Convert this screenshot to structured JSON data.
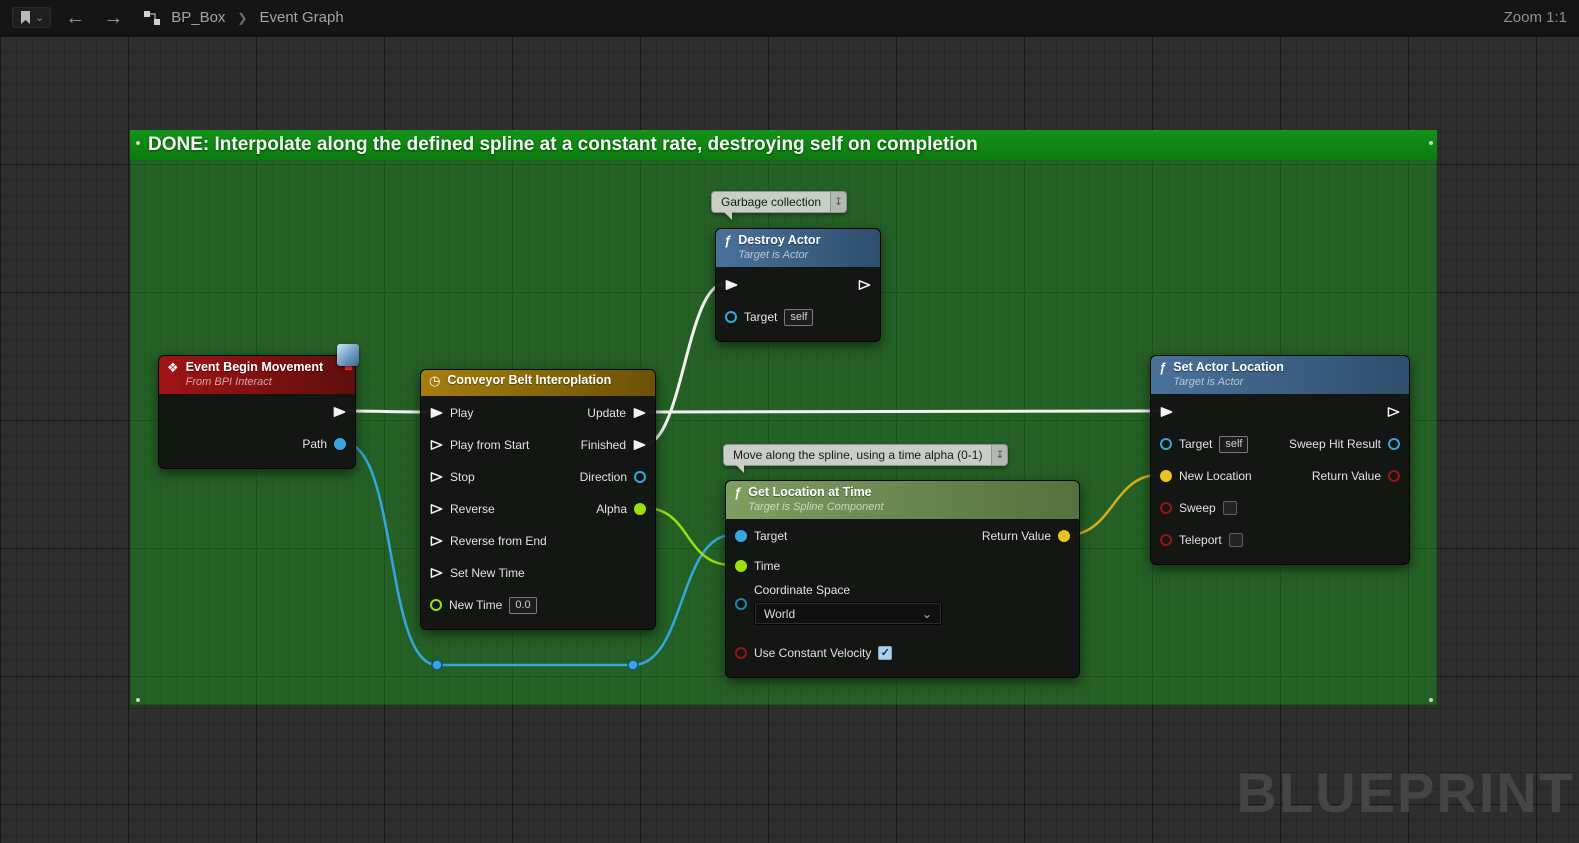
{
  "toolbar": {
    "breadcrumb_root": "BP_Box",
    "breadcrumb_current": "Event Graph",
    "zoom_label": "Zoom 1:1"
  },
  "comment": {
    "title": "DONE: Interpolate along the defined spline at a constant rate, destroying self on completion"
  },
  "watermark": "BLUEPRINT",
  "icons": {
    "function": "ƒ",
    "event": "❖",
    "clock": "◷",
    "back_arrow": "←",
    "forward_arrow": "→",
    "breadcrumb_chevron": "❯",
    "bookmark_chevron": "⌄",
    "dropdown_chevron": "⌄",
    "check": "✓",
    "pin": "↧"
  },
  "colors": {
    "exec": "#f2f2f2",
    "object_pin": "#35a7e0",
    "float_pin": "#9ce00a",
    "bool_pin": "#931515",
    "vector_pin": "#edc120",
    "enum_pin": "#1f86a8",
    "wire_exec": "#f2f2f2",
    "wire_object": "#35a7e0",
    "wire_float": "#9ce00a",
    "wire_vector": "#d8ac1a",
    "comment_green": "#0f8a12"
  },
  "nodes": {
    "event_begin_movement": {
      "title": "Event Begin Movement",
      "subtitle": "From BPI Interact",
      "output_path_label": "Path"
    },
    "conveyor": {
      "title": "Conveyor Belt Interoplation",
      "inputs": [
        "Play",
        "Play from Start",
        "Stop",
        "Reverse",
        "Reverse from End",
        "Set New Time",
        "New Time"
      ],
      "new_time_value": "0.0",
      "outputs": [
        "Update",
        "Finished",
        "Direction",
        "Alpha"
      ]
    },
    "destroy_actor": {
      "bubble": "Garbage collection",
      "title": "Destroy Actor",
      "subtitle": "Target is Actor",
      "target_label": "Target",
      "target_value": "self"
    },
    "get_location": {
      "bubble": "Move along the spline, using a time alpha (0-1)",
      "title": "Get Location at Time",
      "subtitle": "Target is Spline Component",
      "target_label": "Target",
      "time_label": "Time",
      "coordinate_space_label": "Coordinate Space",
      "coordinate_space_value": "World",
      "use_constant_velocity_label": "Use Constant Velocity",
      "use_constant_velocity_checked": true,
      "return_label": "Return Value"
    },
    "set_actor_location": {
      "title": "Set Actor Location",
      "subtitle": "Target is Actor",
      "target_label": "Target",
      "target_value": "self",
      "new_location_label": "New Location",
      "sweep_label": "Sweep",
      "teleport_label": "Teleport",
      "sweep_hit_result_label": "Sweep Hit Result",
      "return_label": "Return Value"
    }
  }
}
